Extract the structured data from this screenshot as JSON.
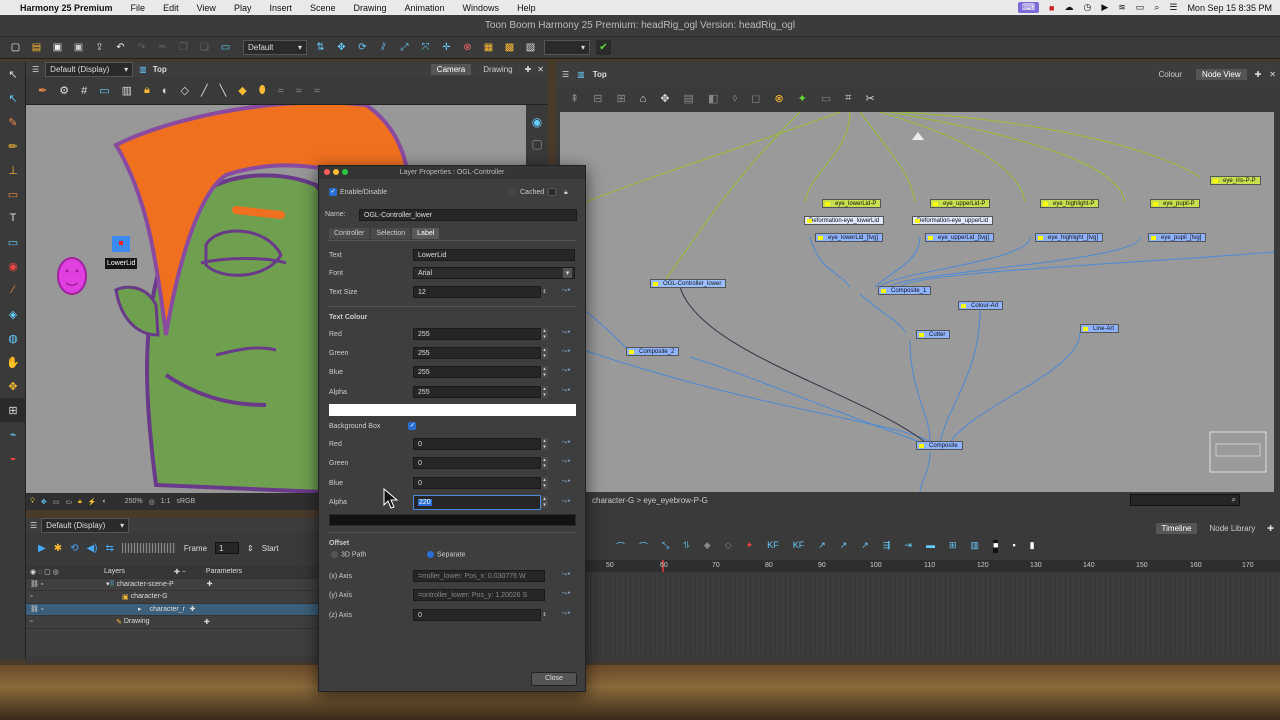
{
  "menubar": {
    "app_name": "Harmony 25 Premium",
    "items": [
      "File",
      "Edit",
      "View",
      "Play",
      "Insert",
      "Scene",
      "Drawing",
      "Animation",
      "Windows",
      "Help"
    ],
    "datetime": "Mon Sep 15  8:35 PM"
  },
  "window": {
    "title": "Toon Boom Harmony 25 Premium: headRig_ogl Version: headRig_ogl"
  },
  "toolbar": {
    "workspace": "Default"
  },
  "camera_view": {
    "display": "Default (Display)",
    "breadcrumb": "Top",
    "tabs": [
      "Camera",
      "Drawing"
    ],
    "label_overlay": "LowerLid",
    "zoom": "250%",
    "colorspace": "sRGB",
    "ratio": "1:1"
  },
  "node_view": {
    "breadcrumb": "Top",
    "tabs": [
      "Colour",
      "Node View"
    ],
    "path": "character-G  >  eye_eyebrow-P-G",
    "nodes": {
      "eye_lowerLid_P": "eye_lowerLid-P",
      "eye_upperLid_P": "eye_upperLid-P",
      "eye_highlight_P": "eye_highlight-P",
      "eye_pupil_P": "eye_pupil-P",
      "eye_iris_P": "eye_iris-P-P",
      "deform_lower": "Deformation-eye_lowerLid",
      "deform_upper": "Deformation-eye_upperLid",
      "lowerLid_tvg": "eye_lowerLid_[tvg]",
      "upperLid_tvg": "eye_upperLid_[tvg]",
      "highlight_tvg": "eye_highlight_[tvg]",
      "pupil_tvg": "eye_pupil_[tvg]",
      "ogl": "OGL-Controller_lower",
      "composite1": "Composite_1",
      "colour_art": "Colour-Art",
      "cutter": "Cutter",
      "line_art": "Line-Art",
      "composite2": "Composite_2",
      "composite": "Composite"
    }
  },
  "timeline": {
    "display": "Default (Display)",
    "frame_label": "Frame",
    "frame_value": "1",
    "start_label": "Start",
    "tabs": [
      "Timeline",
      "Node Library"
    ],
    "col_layers": "Layers",
    "col_params": "Parameters",
    "layers": [
      "character-scene-P",
      "character-G",
      "character_r",
      "Drawing"
    ],
    "frame_ticks": [
      "50",
      "60",
      "70",
      "80",
      "90",
      "100",
      "110",
      "120",
      "130",
      "140",
      "150",
      "160",
      "170"
    ]
  },
  "dialog": {
    "title": "Layer Properties : OGL-Controller",
    "enable_label": "Enable/Disable",
    "cached_label": "Cached",
    "name_label": "Name:",
    "name_value": "OGL-Controller_lower",
    "tabs": [
      "Controller",
      "Selection",
      "Label"
    ],
    "text_label": "Text",
    "text_value": "LowerLid",
    "font_label": "Font",
    "font_value": "Arial",
    "size_label": "Text Size",
    "size_value": "12",
    "text_colour_label": "Text Colour",
    "red_label": "Red",
    "green_label": "Green",
    "blue_label": "Blue",
    "alpha_label": "Alpha",
    "tc_red": "255",
    "tc_green": "255",
    "tc_blue": "255",
    "tc_alpha": "255",
    "bg_label": "Background Box",
    "bg_red": "0",
    "bg_green": "0",
    "bg_blue": "0",
    "bg_alpha": "220",
    "offset_label": "Offset",
    "path3d_label": "3D Path",
    "separate_label": "Separate",
    "x_label": "(x) Axis",
    "y_label": "(y) Axis",
    "z_label": "(z) Axis",
    "x_value": "=rroller_lower: Pos_x: 0.030776 W",
    "y_value": "=ontroller_lower: Pos_y: 1.20026 S",
    "z_value": "0",
    "close_label": "Close"
  }
}
